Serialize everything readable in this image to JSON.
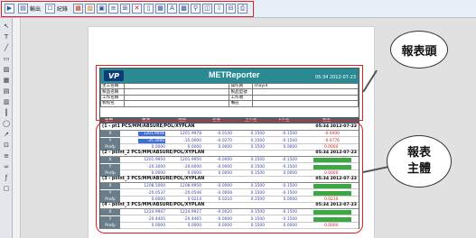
{
  "toolbar": {
    "btn_label_a": "輸出",
    "btn_label_b": "紀錄"
  },
  "report": {
    "logo": "VP",
    "title": "METReporter",
    "date": "05:34 2012-07-23",
    "header_labels": [
      "主工名稱",
      "製品名稱",
      "工作名稱",
      "製程名"
    ],
    "header_right_labels": [
      "操作員",
      "製品型號",
      "工作號",
      "備註"
    ],
    "operator_value": "shayi4",
    "column_headers": [
      "名稱",
      "實測",
      "理論",
      "差值",
      "上公差",
      "下公差",
      "超差"
    ]
  },
  "sections": [
    {
      "title": "(1 - pt1 PCS/MM/ABSURE/POL/XYPLAN",
      "date": "05:34 2012-07-23",
      "rows": [
        {
          "label": "X",
          "v1": "1201.9956",
          "v2": "1201.9978",
          "v3": "-0.0140",
          "v4": "0.1500",
          "v5": "-0.1500",
          "v6": "-0.0000",
          "kind": "blue"
        },
        {
          "label": "Y",
          "v1": "-35.3000",
          "v2": "-35.0000",
          "v3": "-0.0270",
          "v4": "0.1500",
          "v5": "-0.1500",
          "v6": "-0.0776",
          "kind": "blue"
        },
        {
          "label": "Profp",
          "v1": "0.0000",
          "v2": "0.0000",
          "v3": "0.0000",
          "v4": "0.1500",
          "v5": "0.0000",
          "v6": "0.0000",
          "kind": "plain"
        }
      ]
    },
    {
      "title": "(2 - point_2 PCS/MM/ABSURE/POL/XYPLAN",
      "date": "05:34 2012-07-23",
      "rows": [
        {
          "label": "X",
          "v1": "1201.9950",
          "v2": "1201.9950",
          "v3": "-0.0000",
          "v4": "0.1500",
          "v5": "-0.1500",
          "v6": "",
          "kind": "green"
        },
        {
          "label": "Y",
          "v1": "-20.3000",
          "v2": "-20.0000",
          "v3": "-0.0000",
          "v4": "0.1500",
          "v5": "-0.1500",
          "v6": "",
          "kind": "green"
        },
        {
          "label": "Profp",
          "v1": "0.0000",
          "v2": "0.0000",
          "v3": "0.0000",
          "v4": "0.1500",
          "v5": "0.0000",
          "v6": "0.0000",
          "kind": "plain"
        }
      ]
    },
    {
      "title": "(3 - point_3 PCS/MM/ABSURE/POL/XYPLAN",
      "date": "05:34 2012-07-23",
      "rows": [
        {
          "label": "X",
          "v1": "1208.5000",
          "v2": "1208.9950",
          "v3": "-0.0000",
          "v4": "0.1500",
          "v5": "-0.1500",
          "v6": "",
          "kind": "green"
        },
        {
          "label": "Y",
          "v1": "-20.0537",
          "v2": "-20.0546",
          "v3": "-0.0008",
          "v4": "0.1500",
          "v5": "-0.1500",
          "v6": "",
          "kind": "green"
        },
        {
          "label": "Profp",
          "v1": "0.0000",
          "v2": "0.0214",
          "v3": "0.0210",
          "v4": "0.1500",
          "v5": "0.0000",
          "v6": "0.0210",
          "kind": "plain"
        }
      ]
    },
    {
      "title": "(4 - point_3 PCS/MM/ABSURE/POL/XYPLAN",
      "date": "05:34 2012-07-23",
      "rows": [
        {
          "label": "X",
          "v1": "1224.9947",
          "v2": "1224.9927",
          "v3": "-0.0020",
          "v4": "0.1500",
          "v5": "-0.1500",
          "v6": "",
          "kind": "green"
        },
        {
          "label": "Y",
          "v1": "-20.4405",
          "v2": "-20.4465",
          "v3": "-0.0000",
          "v4": "0.1500",
          "v5": "-0.1500",
          "v6": "",
          "kind": "green"
        },
        {
          "label": "Profp",
          "v1": "0.0000",
          "v2": "0.0000",
          "v3": "0.0000",
          "v4": "0.1500",
          "v5": "0.0000",
          "v6": "0.0000",
          "kind": "plain"
        }
      ]
    }
  ],
  "callouts": {
    "header_label": "報表頭",
    "body_label_1": "報表",
    "body_label_2": "主體"
  },
  "colors": {
    "accent_red": "#e02020",
    "title_teal": "#2a8a93",
    "pass_green": "#3ca843",
    "value_blue": "#3a6fd6"
  }
}
